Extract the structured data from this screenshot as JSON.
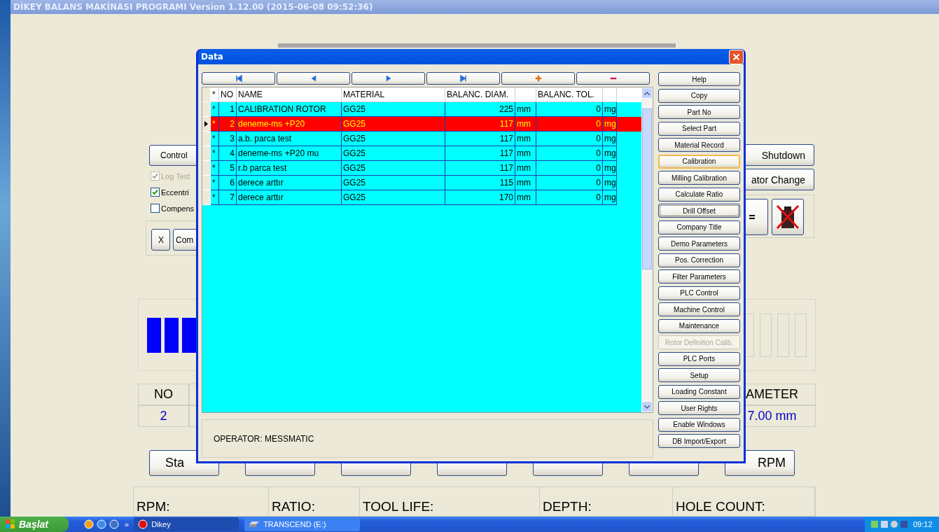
{
  "main_window": {
    "title": "DİKEY BALANS MAKİNASI PROGRAMI Version 1.12.00 (2015-06-08 09:52:36)",
    "left_panel": {
      "control_button": "Control",
      "checkboxes": [
        {
          "label": "Log Test",
          "checked": true,
          "disabled": true
        },
        {
          "label": "Eccentri",
          "checked": true,
          "disabled": false
        },
        {
          "label": "Compens",
          "checked": false,
          "disabled": false
        }
      ],
      "group_buttons": [
        "X",
        "Com"
      ]
    },
    "right_panel": {
      "buttons": [
        "Shutdown",
        "ator Change"
      ]
    },
    "result_table": {
      "columns": [
        "NO",
        "AMETER"
      ],
      "row": [
        "2",
        "7.00 mm"
      ]
    },
    "start_button": "Sta",
    "rpm_button": "RPM",
    "status_fields": [
      "RPM:",
      "RATIO:",
      "TOOL LIFE:",
      "DEPTH:",
      "HOLE COUNT:"
    ]
  },
  "dialog": {
    "title": "Data",
    "columns": [
      "*",
      "NO",
      "NAME",
      "MATERIAL",
      "BALANC. DIAM.",
      "BALANC. TOL."
    ],
    "rows": [
      {
        "marker": "*",
        "no": "1",
        "name": "CALIBRATION ROTOR",
        "material": "GG25",
        "diam": "225",
        "diam_unit": "mm",
        "tol": "0",
        "tol_unit": "mg",
        "selected": false
      },
      {
        "marker": "*",
        "no": "2",
        "name": "deneme-ms +P20",
        "material": "GG25",
        "diam": "117",
        "diam_unit": "mm",
        "tol": "0",
        "tol_unit": "mg",
        "selected": true
      },
      {
        "marker": "*",
        "no": "3",
        "name": "a.b. parca test",
        "material": "GG25",
        "diam": "117",
        "diam_unit": "mm",
        "tol": "0",
        "tol_unit": "mg",
        "selected": false
      },
      {
        "marker": "*",
        "no": "4",
        "name": "deneme-ms +P20 mu",
        "material": "GG25",
        "diam": "117",
        "diam_unit": "mm",
        "tol": "0",
        "tol_unit": "mg",
        "selected": false
      },
      {
        "marker": "*",
        "no": "5",
        "name": "r.b parca test",
        "material": "GG25",
        "diam": "117",
        "diam_unit": "mm",
        "tol": "0",
        "tol_unit": "mg",
        "selected": false
      },
      {
        "marker": "*",
        "no": "6",
        "name": "derece arttır",
        "material": "GG25",
        "diam": "115",
        "diam_unit": "mm",
        "tol": "0",
        "tol_unit": "mg",
        "selected": false
      },
      {
        "marker": "*",
        "no": "7",
        "name": "derece arttır",
        "material": "GG25",
        "diam": "170",
        "diam_unit": "mm",
        "tol": "0",
        "tol_unit": "mg",
        "selected": false
      }
    ],
    "operator": "OPERATOR: MESSMATIC",
    "side_buttons": [
      {
        "label": "Help",
        "disabled": false,
        "hot": false,
        "focused": false
      },
      {
        "label": "Copy",
        "disabled": false,
        "hot": false,
        "focused": false
      },
      {
        "label": "Part No",
        "disabled": false,
        "hot": false,
        "focused": false
      },
      {
        "label": "Select Part",
        "disabled": false,
        "hot": false,
        "focused": false
      },
      {
        "label": "Material Record",
        "disabled": false,
        "hot": false,
        "focused": false
      },
      {
        "label": "Calibration",
        "disabled": false,
        "hot": true,
        "focused": false
      },
      {
        "label": "Milling Calibration",
        "disabled": false,
        "hot": false,
        "focused": false
      },
      {
        "label": "Calculate Ratio",
        "disabled": false,
        "hot": false,
        "focused": false
      },
      {
        "label": "Drill Offset",
        "disabled": false,
        "hot": false,
        "focused": true
      },
      {
        "label": "Company Title",
        "disabled": false,
        "hot": false,
        "focused": false
      },
      {
        "label": "Demo Parameters",
        "disabled": false,
        "hot": false,
        "focused": false
      },
      {
        "label": "Pos. Correction",
        "disabled": false,
        "hot": false,
        "focused": false
      },
      {
        "label": "Filter Parameters",
        "disabled": false,
        "hot": false,
        "focused": false
      },
      {
        "label": "PLC Control",
        "disabled": false,
        "hot": false,
        "focused": false
      },
      {
        "label": "Machine Control",
        "disabled": false,
        "hot": false,
        "focused": false
      },
      {
        "label": "Maintenance",
        "disabled": false,
        "hot": false,
        "focused": false
      },
      {
        "label": "Rotor Definition Calib.",
        "disabled": true,
        "hot": false,
        "focused": false
      },
      {
        "label": "PLC Ports",
        "disabled": false,
        "hot": false,
        "focused": false
      },
      {
        "label": "Setup",
        "disabled": false,
        "hot": false,
        "focused": false
      },
      {
        "label": "Loading Constant",
        "disabled": false,
        "hot": false,
        "focused": false
      },
      {
        "label": "User Rights",
        "disabled": false,
        "hot": false,
        "focused": false
      },
      {
        "label": "Enable Windows",
        "disabled": false,
        "hot": false,
        "focused": false
      },
      {
        "label": "DB Import/Export",
        "disabled": false,
        "hot": false,
        "focused": false
      }
    ]
  },
  "taskbar": {
    "start": "Başlat",
    "chevron": "»",
    "tasks": [
      {
        "label": "Dikey",
        "selected": true
      },
      {
        "label": "TRANSCEND (E:)",
        "selected": false
      }
    ],
    "clock": "09:12"
  }
}
